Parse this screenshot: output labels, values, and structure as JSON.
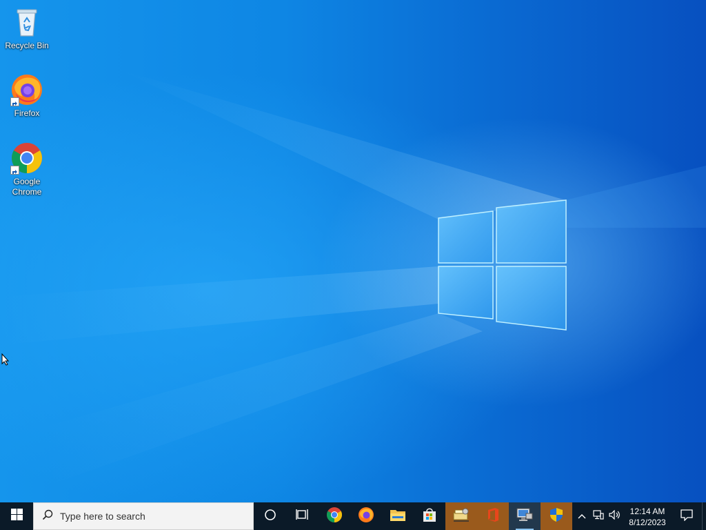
{
  "desktop": {
    "icons": [
      {
        "label": "Recycle Bin",
        "icon": "recycle-bin-icon"
      },
      {
        "label": "Firefox",
        "icon": "firefox-icon",
        "shortcut": true
      },
      {
        "label": "Google Chrome",
        "icon": "chrome-icon",
        "shortcut": true
      }
    ]
  },
  "taskbar": {
    "start_icon": "windows-logo-icon",
    "search": {
      "placeholder": "Type here to search",
      "icon": "search-icon"
    },
    "pinned": [
      {
        "name": "cortana",
        "icon": "cortana-circle-icon"
      },
      {
        "name": "task-view",
        "icon": "task-view-icon"
      },
      {
        "name": "chrome",
        "icon": "chrome-icon"
      },
      {
        "name": "firefox",
        "icon": "firefox-icon"
      },
      {
        "name": "file-explorer",
        "icon": "folder-icon"
      },
      {
        "name": "microsoft-store",
        "icon": "store-bag-icon"
      },
      {
        "name": "app-1",
        "icon": "network-drive-icon",
        "highlighted": true
      },
      {
        "name": "app-2",
        "icon": "office-icon",
        "highlighted": true
      },
      {
        "name": "app-3",
        "icon": "remote-desktop-icon",
        "active": true
      },
      {
        "name": "app-4",
        "icon": "shield-icon",
        "highlighted": true
      }
    ],
    "tray": {
      "icons": [
        "chevron-up-icon",
        "network-icon",
        "volume-icon"
      ],
      "time": "12:14 AM",
      "date": "8/12/2023",
      "notification_icon": "action-center-icon"
    }
  },
  "colors": {
    "taskbar_bg": "#0b1a28",
    "wallpaper_accent": "#0a6fd6",
    "highlight": "#9a5a1c"
  }
}
